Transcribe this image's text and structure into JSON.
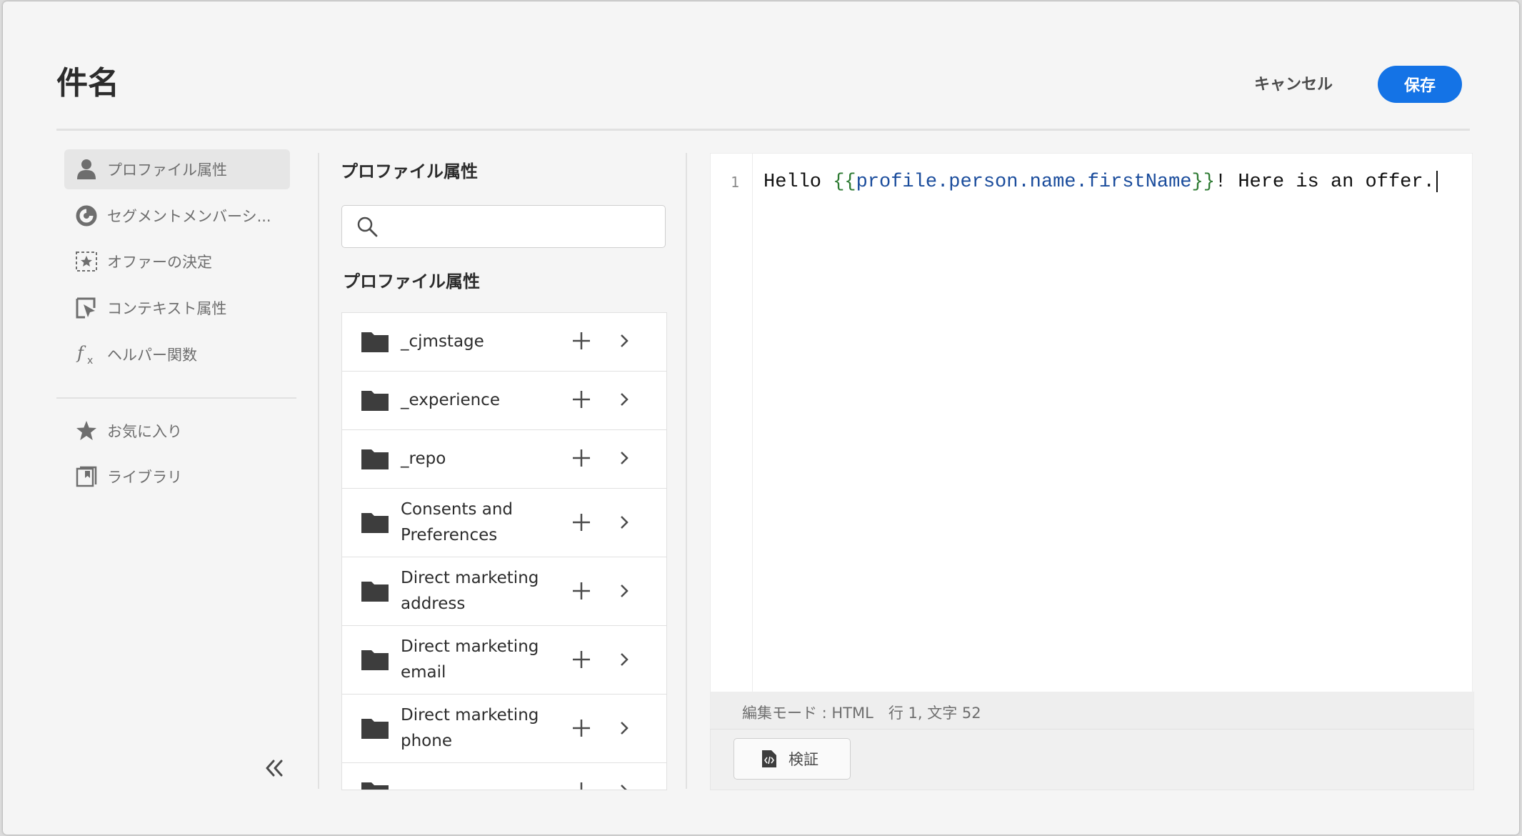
{
  "dialog": {
    "title": "件名",
    "cancel_label": "キャンセル",
    "save_label": "保存"
  },
  "nav": {
    "items": [
      {
        "label": "プロファイル属性",
        "icon": "person-icon",
        "active": true
      },
      {
        "label": "セグメントメンバーシ...",
        "icon": "segment-icon",
        "active": false
      },
      {
        "label": "オファーの決定",
        "icon": "offer-decision-icon",
        "active": false
      },
      {
        "label": "コンテキスト属性",
        "icon": "context-icon",
        "active": false
      },
      {
        "label": "ヘルパー関数",
        "icon": "function-icon",
        "active": false
      }
    ],
    "secondary": [
      {
        "label": "お気に入り",
        "icon": "star-icon"
      },
      {
        "label": "ライブラリ",
        "icon": "library-icon"
      }
    ],
    "collapse_icon": "double-chevron-left-icon"
  },
  "attributes_panel": {
    "title": "プロファイル属性",
    "search": {
      "value": "",
      "placeholder": ""
    },
    "section_title": "プロファイル属性",
    "rows": [
      {
        "label": "_cjmstage"
      },
      {
        "label": "_experience"
      },
      {
        "label": "_repo"
      },
      {
        "label": "Consents and Preferences"
      },
      {
        "label": "Direct marketing address"
      },
      {
        "label": "Direct marketing email"
      },
      {
        "label": "Direct marketing phone"
      },
      {
        "label": ""
      }
    ]
  },
  "editor": {
    "line_number": "1",
    "code": {
      "prefix": "Hello ",
      "open_brace": "{{",
      "token": "profile.person.name.firstName",
      "close_brace": "}}",
      "suffix": "! Here is an offer."
    },
    "status": "編集モード : HTML　行 1, 文字 52",
    "validate_label": "検証"
  },
  "colors": {
    "accent": "#1473e6",
    "code_brace": "#2d7a32",
    "code_token": "#1a4c9c"
  }
}
